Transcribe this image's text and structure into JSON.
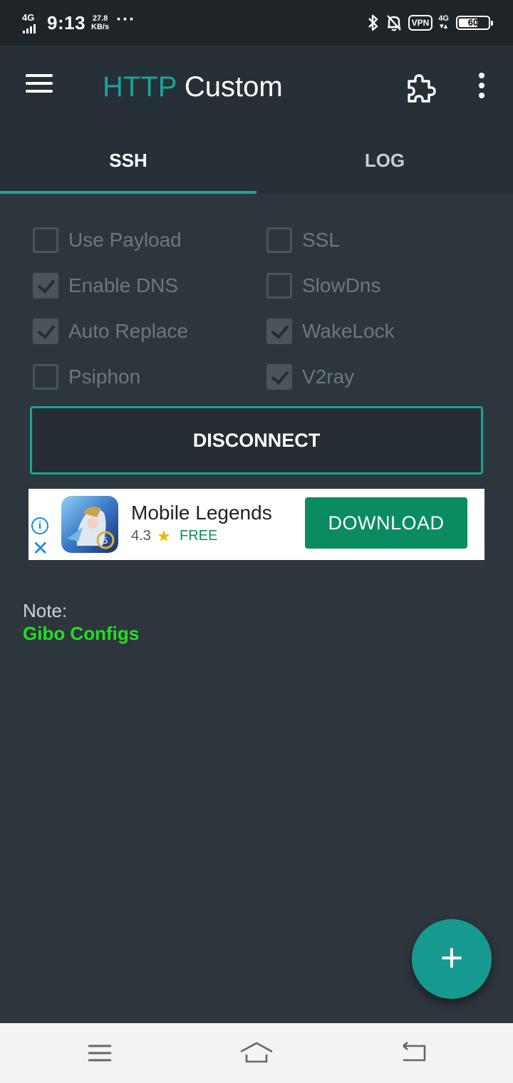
{
  "status_bar": {
    "network": "4G",
    "time": "9:13",
    "speed_value": "27.8",
    "speed_unit": "KB/s",
    "more": "···",
    "vpn": "VPN",
    "network_right": "4G",
    "battery": "60",
    "icons": [
      "bluetooth-icon",
      "bell-off-icon",
      "vpn-icon",
      "signal-icon",
      "battery-icon"
    ]
  },
  "toolbar": {
    "title_accent": "HTTP",
    "title_rest": "Custom",
    "accent_color": "#1ba39a",
    "icons": [
      "menu-icon",
      "puzzle-icon",
      "more-vert-icon"
    ]
  },
  "tabs": [
    {
      "label": "SSH",
      "selected": true
    },
    {
      "label": "LOG",
      "selected": false
    }
  ],
  "options": [
    {
      "label": "Use Payload",
      "checked": false
    },
    {
      "label": "SSL",
      "checked": false
    },
    {
      "label": "Enable DNS",
      "checked": true
    },
    {
      "label": "SlowDns",
      "checked": false
    },
    {
      "label": "Auto Replace",
      "checked": true
    },
    {
      "label": "WakeLock",
      "checked": true
    },
    {
      "label": "Psiphon",
      "checked": false
    },
    {
      "label": "V2ray",
      "checked": true
    }
  ],
  "action": {
    "label": "DISCONNECT"
  },
  "ad": {
    "app_name": "Mobile Legends",
    "rating": "4.3",
    "price": "FREE",
    "cta": "DOWNLOAD",
    "info_glyph": "i",
    "close_glyph": "✕"
  },
  "note": {
    "label": "Note:",
    "value": "Gibo Configs"
  },
  "fab": {
    "glyph": "+"
  }
}
